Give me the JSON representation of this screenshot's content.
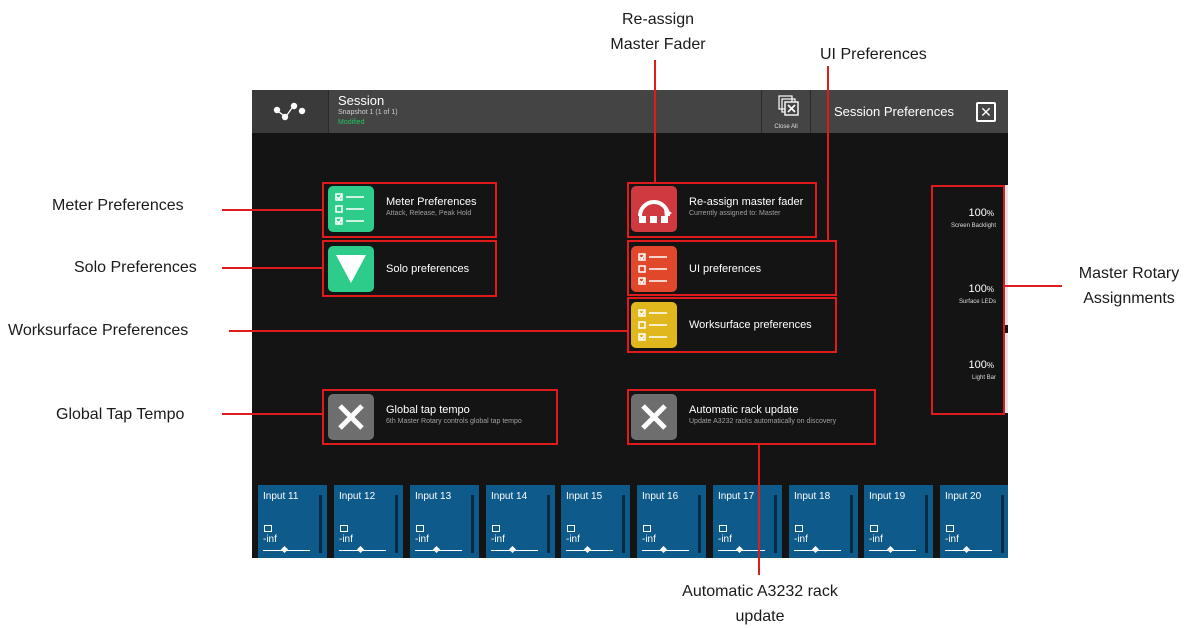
{
  "callouts": {
    "reassign_line1": "Re-assign",
    "reassign_line2": "Master Fader",
    "ui_prefs": "UI Preferences",
    "meter_prefs": "Meter Preferences",
    "solo_prefs": "Solo Preferences",
    "worksurface_prefs": "Worksurface Preferences",
    "global_tap": "Global Tap Tempo",
    "master_rotary_line1": "Master Rotary",
    "master_rotary_line2": "Assignments",
    "auto_rack_line1": "Automatic A3232 rack",
    "auto_rack_line2": "update"
  },
  "header": {
    "session_title": "Session",
    "snapshot": "Snapshot 1 (1 of 1)",
    "status": "Modified",
    "close_all": "Close All",
    "panel_title": "Session Preferences"
  },
  "options": {
    "meter": {
      "title": "Meter Preferences",
      "subtitle": "Attack, Release, Peak Hold"
    },
    "solo": {
      "title": "Solo preferences"
    },
    "reassign": {
      "title": "Re-assign master fader",
      "subtitle": "Currently assigned to: Master"
    },
    "ui": {
      "title": "UI preferences"
    },
    "worksurface": {
      "title": "Worksurface preferences"
    },
    "global_tap": {
      "title": "Global tap tempo",
      "subtitle": "6th Master Rotary controls global tap tempo"
    },
    "auto_rack": {
      "title": "Automatic rack update",
      "subtitle": "Update A3232 racks automatically on discovery"
    }
  },
  "rotaries": [
    {
      "value": "100",
      "unit": "%",
      "label": "Screen Backlight"
    },
    {
      "value": "100",
      "unit": "%",
      "label": "Surface LEDs"
    },
    {
      "value": "100",
      "unit": "%",
      "label": "Light Bar"
    }
  ],
  "strips": [
    {
      "name": "Input 11",
      "level": "-inf"
    },
    {
      "name": "Input 12",
      "level": "-inf"
    },
    {
      "name": "Input 13",
      "level": "-inf"
    },
    {
      "name": "Input 14",
      "level": "-inf"
    },
    {
      "name": "Input 15",
      "level": "-inf"
    },
    {
      "name": "Input 16",
      "level": "-inf"
    },
    {
      "name": "Input 17",
      "level": "-inf"
    },
    {
      "name": "Input 18",
      "level": "-inf"
    },
    {
      "name": "Input 19",
      "level": "-inf"
    },
    {
      "name": "Input 20",
      "level": "-inf"
    }
  ],
  "colors": {
    "annotation": "#e01b1b",
    "meter_icon": "#2ecc8a",
    "solo_icon": "#2ecc8a",
    "reassign_icon": "#d0393f",
    "ui_icon": "#e0472b",
    "worksurface_icon": "#e0b71c",
    "disabled_icon": "#6e6e6e",
    "strip": "#0e5a8a"
  }
}
